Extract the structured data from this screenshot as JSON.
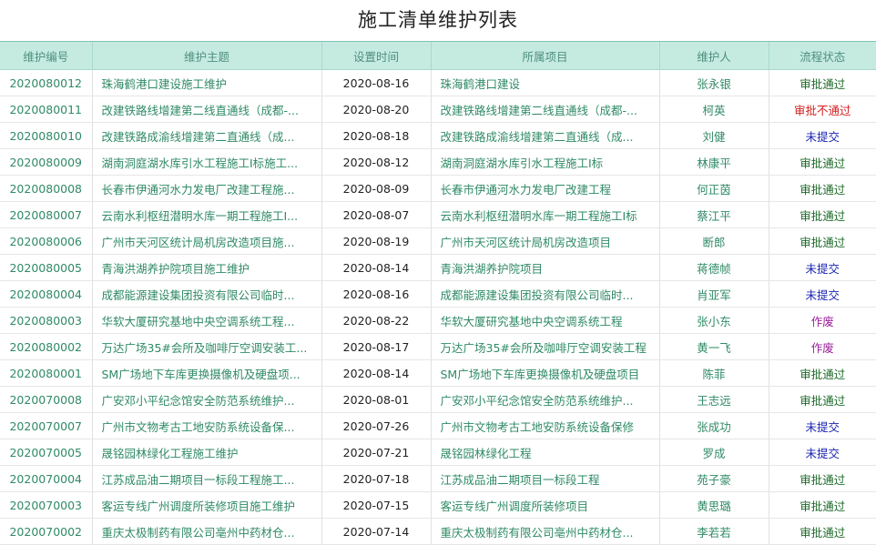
{
  "page": {
    "title": "施工清单维护列表"
  },
  "table": {
    "headers": [
      "维护编号",
      "维护主题",
      "设置时间",
      "所属项目",
      "维护人",
      "流程状态"
    ],
    "status_colors": {
      "审批通过": "#1e6b2a",
      "审批不通过": "#d42020",
      "未提交": "#1a24b0",
      "作废": "#9b1f9b"
    },
    "rows": [
      {
        "id": "2020080012",
        "subject": "珠海鹤港口建设施工维护",
        "date": "2020-08-16",
        "project": "珠海鹤港口建设",
        "person": "张永银",
        "status": "审批通过"
      },
      {
        "id": "2020080011",
        "subject": "改建铁路线增建第二线直通线（成都-...",
        "date": "2020-08-20",
        "project": "改建铁路线增建第二线直通线（成都-...",
        "person": "柯英",
        "status": "审批不通过"
      },
      {
        "id": "2020080010",
        "subject": "改建铁路成渝线增建第二直通线（成...",
        "date": "2020-08-18",
        "project": "改建铁路成渝线增建第二直通线（成...",
        "person": "刘健",
        "status": "未提交"
      },
      {
        "id": "2020080009",
        "subject": "湖南洞庭湖水库引水工程施工I标施工...",
        "date": "2020-08-12",
        "project": "湖南洞庭湖水库引水工程施工I标",
        "person": "林康平",
        "status": "审批通过"
      },
      {
        "id": "2020080008",
        "subject": "长春市伊通河水力发电厂改建工程施...",
        "date": "2020-08-09",
        "project": "长春市伊通河水力发电厂改建工程",
        "person": "何正茵",
        "status": "审批通过"
      },
      {
        "id": "2020080007",
        "subject": "云南水利枢纽潜明水库一期工程施工I...",
        "date": "2020-08-07",
        "project": "云南水利枢纽潜明水库一期工程施工I标",
        "person": "蔡江平",
        "status": "审批通过"
      },
      {
        "id": "2020080006",
        "subject": "广州市天河区统计局机房改造项目施...",
        "date": "2020-08-19",
        "project": "广州市天河区统计局机房改造项目",
        "person": "断郎",
        "status": "审批通过"
      },
      {
        "id": "2020080005",
        "subject": "青海洪湖养护院项目施工维护",
        "date": "2020-08-14",
        "project": "青海洪湖养护院项目",
        "person": "蒋德帧",
        "status": "未提交"
      },
      {
        "id": "2020080004",
        "subject": "成都能源建设集团投资有限公司临时...",
        "date": "2020-08-16",
        "project": "成都能源建设集团投资有限公司临时...",
        "person": "肖亚军",
        "status": "未提交"
      },
      {
        "id": "2020080003",
        "subject": "华软大厦研究基地中央空调系统工程...",
        "date": "2020-08-22",
        "project": "华软大厦研究基地中央空调系统工程",
        "person": "张小东",
        "status": "作废"
      },
      {
        "id": "2020080002",
        "subject": "万达广场35#会所及咖啡厅空调安装工...",
        "date": "2020-08-17",
        "project": "万达广场35#会所及咖啡厅空调安装工程",
        "person": "黄一飞",
        "status": "作废"
      },
      {
        "id": "2020080001",
        "subject": "SM广场地下车库更换摄像机及硬盘项...",
        "date": "2020-08-14",
        "project": "SM广场地下车库更换摄像机及硬盘项目",
        "person": "陈菲",
        "status": "审批通过"
      },
      {
        "id": "2020070008",
        "subject": "广安邓小平纪念馆安全防范系统维护...",
        "date": "2020-08-01",
        "project": "广安邓小平纪念馆安全防范系统维护...",
        "person": "王志远",
        "status": "审批通过"
      },
      {
        "id": "2020070007",
        "subject": "广州市文物考古工地安防系统设备保...",
        "date": "2020-07-26",
        "project": "广州市文物考古工地安防系统设备保修",
        "person": "张成功",
        "status": "未提交"
      },
      {
        "id": "2020070005",
        "subject": "晟铭园林绿化工程施工维护",
        "date": "2020-07-21",
        "project": "晟铭园林绿化工程",
        "person": "罗成",
        "status": "未提交"
      },
      {
        "id": "2020070004",
        "subject": "江苏成品油二期项目一标段工程施工...",
        "date": "2020-07-18",
        "project": "江苏成品油二期项目一标段工程",
        "person": "苑子豪",
        "status": "审批通过"
      },
      {
        "id": "2020070003",
        "subject": "客运专线广州调度所装修项目施工维护",
        "date": "2020-07-15",
        "project": "客运专线广州调度所装修项目",
        "person": "黄思璐",
        "status": "审批通过"
      },
      {
        "id": "2020070002",
        "subject": "重庆太极制药有限公司亳州中药材仓...",
        "date": "2020-07-14",
        "project": "重庆太极制药有限公司亳州中药材仓...",
        "person": "李若若",
        "status": "审批通过"
      }
    ]
  }
}
